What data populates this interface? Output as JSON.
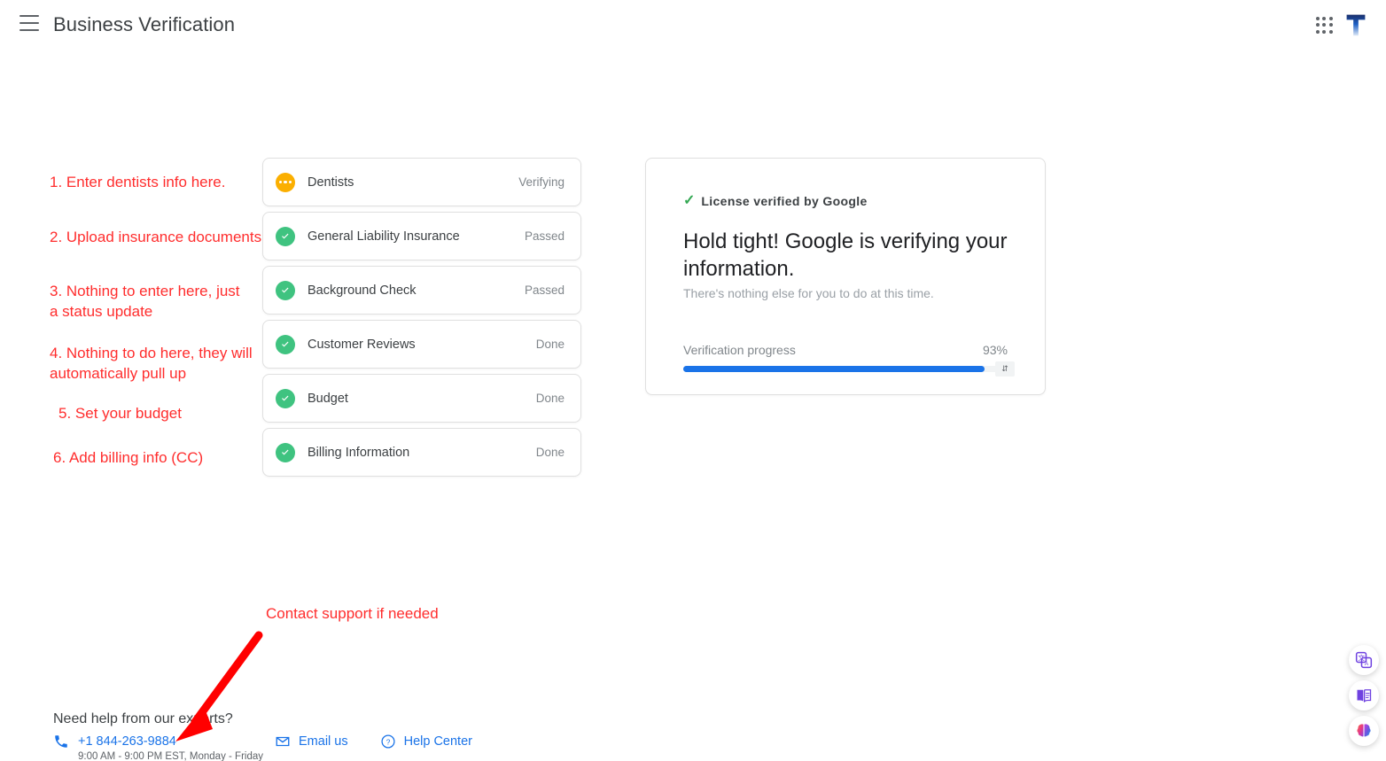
{
  "header": {
    "title": "Business Verification",
    "menu_icon": "hamburger-menu-icon",
    "apps_icon": "google-apps-grid-icon",
    "avatar_letter": "T"
  },
  "tasks": [
    {
      "label": "Dentists",
      "status": "Verifying",
      "icon": "in-progress-dots-icon"
    },
    {
      "label": "General Liability Insurance",
      "status": "Passed",
      "icon": "check-circle-icon"
    },
    {
      "label": "Background Check",
      "status": "Passed",
      "icon": "check-circle-icon"
    },
    {
      "label": "Customer Reviews",
      "status": "Done",
      "icon": "check-circle-icon"
    },
    {
      "label": "Budget",
      "status": "Done",
      "icon": "check-circle-icon"
    },
    {
      "label": "Billing Information",
      "status": "Done",
      "icon": "check-circle-icon"
    }
  ],
  "verify_card": {
    "license_text": "License verified by Google",
    "license_icon": "green-check-icon",
    "headline": "Hold tight! Google is verifying your information.",
    "subtitle": "There's nothing else for you to do at this time.",
    "progress_label": "Verification progress",
    "progress_percent_text": "93%",
    "progress_percent": 93
  },
  "annotations": [
    "1. Enter dentists info here.",
    "2. Upload insurance documents",
    "3. Nothing to enter here, just\na status update",
    "4. Nothing to do here, they will\nautomatically pull up",
    "5. Set your budget",
    "6. Add billing info (CC)",
    "Contact support if needed"
  ],
  "support": {
    "title": "Need help from our experts?",
    "phone": "+1 844-263-9884",
    "phone_icon": "phone-icon",
    "hours": "9:00 AM - 9:00 PM EST, Monday - Friday",
    "email_label": "Email us",
    "email_icon": "envelope-icon",
    "help_label": "Help Center",
    "help_icon": "question-circle-icon"
  },
  "floating_buttons": [
    {
      "icon": "translate-icon"
    },
    {
      "icon": "book-icon"
    },
    {
      "icon": "brain-icon"
    }
  ],
  "colors": {
    "accent_blue": "#1a73e8",
    "success_green": "#3fc380",
    "pending_orange": "#fbaf00",
    "annotation_red": "#ff2d2d"
  }
}
